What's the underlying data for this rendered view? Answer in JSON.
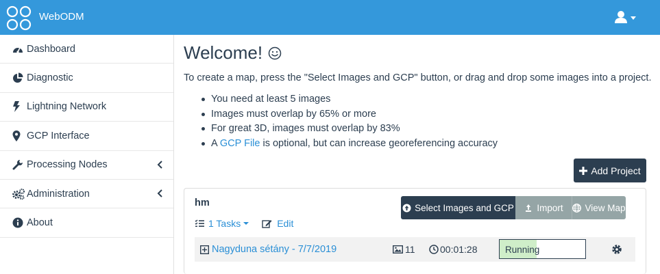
{
  "app": {
    "brand": "WebODM"
  },
  "sidebar": {
    "items": [
      {
        "label": "Dashboard",
        "icon": "dashboard-icon"
      },
      {
        "label": "Diagnostic",
        "icon": "pie-chart-icon"
      },
      {
        "label": "Lightning Network",
        "icon": "bolt-icon"
      },
      {
        "label": "GCP Interface",
        "icon": "map-marker-icon"
      },
      {
        "label": "Processing Nodes",
        "icon": "wrench-icon",
        "expandable": true
      },
      {
        "label": "Administration",
        "icon": "cogs-icon",
        "expandable": true
      },
      {
        "label": "About",
        "icon": "info-circle-icon"
      }
    ]
  },
  "welcome": {
    "title": "Welcome!",
    "intro": "To create a map, press the \"Select Images and GCP\" button, or drag and drop some images into a project.",
    "tips": [
      "You need at least 5 images",
      "Images must overlap by 65% or more",
      "For great 3D, images must overlap by 83%"
    ],
    "gcp_tip": {
      "prefix": "A ",
      "link": "GCP File",
      "suffix": " is optional, but can increase georeferencing accuracy"
    }
  },
  "toolbar": {
    "add_project": "Add Project"
  },
  "project": {
    "name": "hm",
    "tasks_link": "1 Tasks",
    "edit_link": "Edit",
    "select_button": "Select Images and GCP",
    "import_button": "Import",
    "view_map_button": "View Map"
  },
  "task": {
    "name": "Nagyduna sétány - 7/7/2019",
    "images": "11",
    "elapsed": "00:01:28",
    "status": "Running",
    "progress_fraction": 0.43
  },
  "colors": {
    "topbar": "#3498db",
    "primary_dark": "#2c3e50",
    "secondary": "#95a5a6",
    "link": "#2a8fd6",
    "progress": "#cfeec9"
  }
}
